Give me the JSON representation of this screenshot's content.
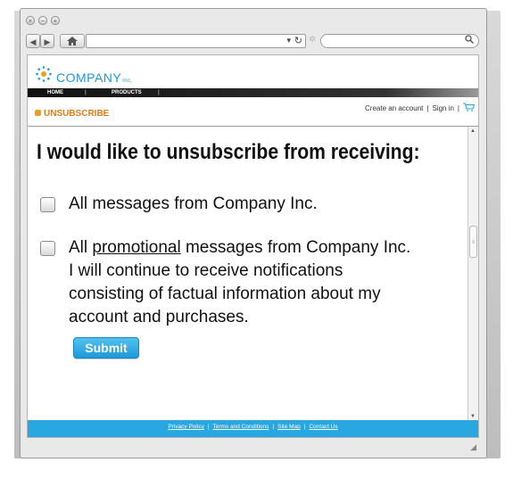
{
  "browser": {
    "back_icon": "◀",
    "forward_icon": "▶",
    "home_icon": "home-icon",
    "dropdown_icon": "▾",
    "reload_icon": "↻",
    "search_icon": "⚲"
  },
  "site": {
    "logo_text": "COMPANY",
    "logo_suffix": "Inc.",
    "nav": [
      "HOME",
      "PRODUCTS"
    ],
    "section_label": "UNSUBSCRIBE",
    "create_account": "Create an account",
    "sign_in": "Sign in"
  },
  "form": {
    "heading": "I would like to unsubscribe from receiving:",
    "option1": "All messages from Company Inc.",
    "option2_prefix": "All ",
    "option2_underlined": "promotional",
    "option2_rest": " messages from Company Inc.",
    "option2_note_1": "I will continue to receive notifications",
    "option2_note_2": "consisting of factual information about my",
    "option2_note_3": "account and purchases.",
    "submit_label": "Submit"
  },
  "footer": {
    "links": [
      "Privacy Policy",
      "Terms and Conditions",
      "Site Map",
      "Contact Us"
    ]
  },
  "colors": {
    "accent": "#28a7e1",
    "unsubscribe": "#e07b18",
    "logo": "#1b98d6"
  }
}
